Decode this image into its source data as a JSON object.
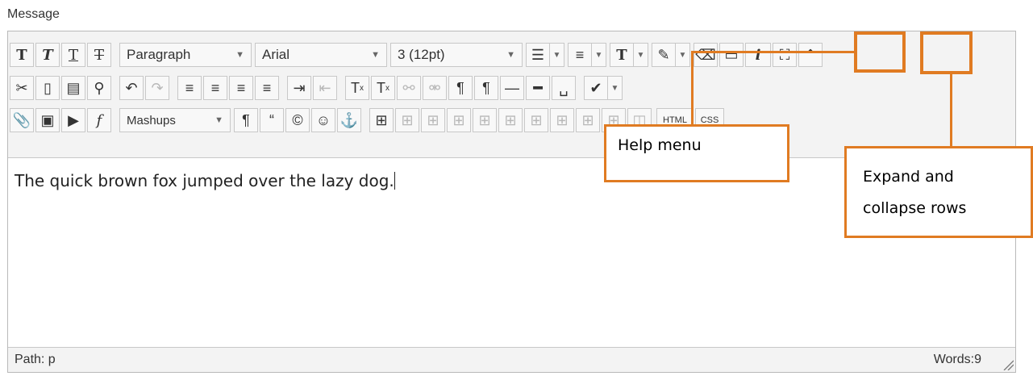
{
  "label": "Message",
  "toolbar": {
    "row1": {
      "format_block": "Paragraph",
      "font_family": "Arial",
      "font_size": "3 (12pt)"
    },
    "row3": {
      "mashups": "Mashups",
      "html_label": "HTML",
      "css_label": "CSS"
    }
  },
  "editor": {
    "content": "The quick brown fox jumped over the lazy dog."
  },
  "status": {
    "path": "Path: p",
    "words": "Words:9"
  },
  "callouts": {
    "help_menu": "Help menu",
    "expand_collapse_line1": "Expand and",
    "expand_collapse_line2": "collapse rows"
  },
  "colors": {
    "callout": "#e07b22"
  }
}
